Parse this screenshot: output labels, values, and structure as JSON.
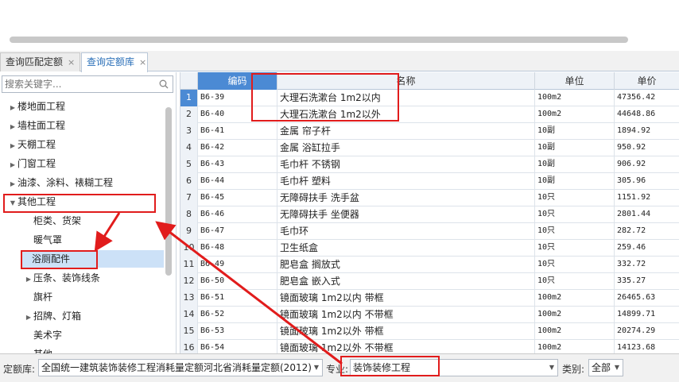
{
  "tabs": [
    {
      "label": "查询匹配定额",
      "close": "×"
    },
    {
      "label": "查询定额库",
      "close": "×"
    }
  ],
  "search": {
    "placeholder": "搜索关键字..."
  },
  "tree": [
    {
      "label": "楼地面工程",
      "arrow": "▶"
    },
    {
      "label": "墙柱面工程",
      "arrow": "▶"
    },
    {
      "label": "天棚工程",
      "arrow": "▶"
    },
    {
      "label": "门窗工程",
      "arrow": "▶"
    },
    {
      "label": "油漆、涂料、裱糊工程",
      "arrow": "▶"
    },
    {
      "label": "其他工程",
      "arrow": "▼"
    },
    {
      "label": "柜类、货架",
      "arrow": ""
    },
    {
      "label": "暖气罩",
      "arrow": ""
    },
    {
      "label": "浴厕配件",
      "arrow": ""
    },
    {
      "label": "压条、装饰线条",
      "arrow": "▶"
    },
    {
      "label": "旗杆",
      "arrow": ""
    },
    {
      "label": "招牌、灯箱",
      "arrow": "▶"
    },
    {
      "label": "美术字",
      "arrow": ""
    },
    {
      "label": "其他",
      "arrow": ""
    }
  ],
  "grid": {
    "headers": {
      "code": "编码",
      "name": "名称",
      "unit": "单位",
      "price": "单价"
    },
    "rows": [
      {
        "n": "1",
        "code": "B6-39",
        "name": "大理石洗漱台 1m2以内",
        "unit": "100m2",
        "price": "47356.42"
      },
      {
        "n": "2",
        "code": "B6-40",
        "name": "大理石洗漱台 1m2以外",
        "unit": "100m2",
        "price": "44648.86"
      },
      {
        "n": "3",
        "code": "B6-41",
        "name": "金属 帘子杆",
        "unit": "10副",
        "price": "1894.92"
      },
      {
        "n": "4",
        "code": "B6-42",
        "name": "金属 浴缸拉手",
        "unit": "10副",
        "price": "950.92"
      },
      {
        "n": "5",
        "code": "B6-43",
        "name": "毛巾杆 不锈钢",
        "unit": "10副",
        "price": "906.92"
      },
      {
        "n": "6",
        "code": "B6-44",
        "name": "毛巾杆 塑料",
        "unit": "10副",
        "price": "305.96"
      },
      {
        "n": "7",
        "code": "B6-45",
        "name": "无障碍扶手 洗手盆",
        "unit": "10只",
        "price": "1151.92"
      },
      {
        "n": "8",
        "code": "B6-46",
        "name": "无障碍扶手 坐便器",
        "unit": "10只",
        "price": "2801.44"
      },
      {
        "n": "9",
        "code": "B6-47",
        "name": "毛巾环",
        "unit": "10只",
        "price": "282.72"
      },
      {
        "n": "10",
        "code": "B6-48",
        "name": "卫生纸盒",
        "unit": "10只",
        "price": "259.46"
      },
      {
        "n": "11",
        "code": "B6-49",
        "name": "肥皂盒 搁放式",
        "unit": "10只",
        "price": "332.72"
      },
      {
        "n": "12",
        "code": "B6-50",
        "name": "肥皂盒 嵌入式",
        "unit": "10只",
        "price": "335.27"
      },
      {
        "n": "13",
        "code": "B6-51",
        "name": "镜面玻璃 1m2以内 带框",
        "unit": "100m2",
        "price": "26465.63"
      },
      {
        "n": "14",
        "code": "B6-52",
        "name": "镜面玻璃 1m2以内 不带框",
        "unit": "100m2",
        "price": "14899.71"
      },
      {
        "n": "15",
        "code": "B6-53",
        "name": "镜面玻璃 1m2以外 带框",
        "unit": "100m2",
        "price": "20274.29"
      },
      {
        "n": "16",
        "code": "B6-54",
        "name": "镜面玻璃 1m2以外 不带框",
        "unit": "100m2",
        "price": "14123.68"
      }
    ]
  },
  "bottom": {
    "quota_label": "定额库:",
    "quota_value": "全国统一建筑装饰装修工程消耗量定额河北省消耗量定额(2012)",
    "major_label": "专业:",
    "major_value": "装饰装修工程",
    "category_label": "类别:",
    "category_value": "全部",
    "caret": "▼"
  },
  "colors": {
    "annotation": "#e11c1c",
    "accent": "#4b8ad4",
    "selected": "#cce1f7"
  }
}
